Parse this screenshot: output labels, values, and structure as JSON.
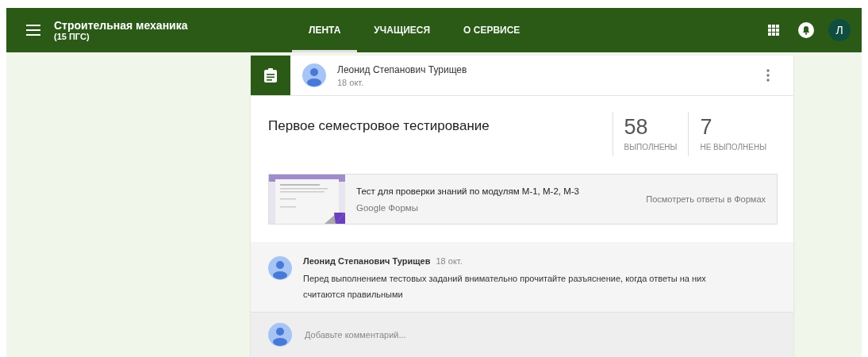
{
  "header": {
    "title": "Строительная механика",
    "subtitle": "(15 ПГС)",
    "avatar_letter": "Л"
  },
  "tabs": [
    {
      "label": "ЛЕНТА",
      "selected": true
    },
    {
      "label": "УЧАЩИЕСЯ",
      "selected": false
    },
    {
      "label": "О СЕРВИСЕ",
      "selected": false
    }
  ],
  "post": {
    "author": "Леонид Степанович Турищев",
    "date": "18 окт.",
    "title": "Первое семестровое тестирование",
    "stats": [
      {
        "value": "58",
        "label": "ВЫПОЛНЕНЫ"
      },
      {
        "value": "7",
        "label": "НЕ ВЫПОЛНЕНЫ"
      }
    ],
    "attachment": {
      "title": "Тест для проверки знаний по модулям М-1, М-2, М-3",
      "source": "Google Формы",
      "action": "Посмотреть ответы в Формах"
    }
  },
  "comments": [
    {
      "author": "Леонид Степанович Турищев",
      "date": "18 окт.",
      "text": "Перед выполнением тестовых заданий внимательно прочитайте разъяснение, когда ответы на них считаются правильными"
    }
  ],
  "comment_field": {
    "placeholder": "Добавьте комментарий..."
  }
}
